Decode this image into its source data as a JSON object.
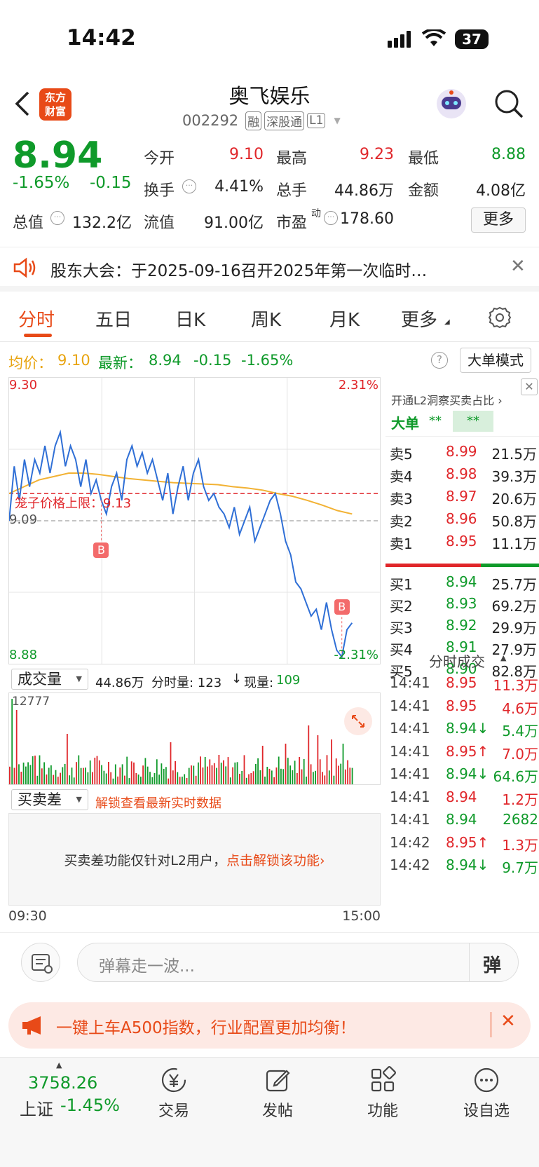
{
  "status_bar": {
    "time": "14:42",
    "battery": "37"
  },
  "header": {
    "logo_line1": "东方",
    "logo_line2": "财富",
    "title": "奥飞娱乐",
    "code": "002292",
    "badges": [
      "融",
      "深股通",
      "L1"
    ]
  },
  "quote": {
    "price": "8.94",
    "change_pct": "-1.65%",
    "change": "-0.15",
    "open_label": "今开",
    "open": "9.10",
    "high_label": "最高",
    "high": "9.23",
    "low_label": "最低",
    "low": "8.88",
    "turnover_label": "换手",
    "turnover": "4.41%",
    "volume_label": "总手",
    "volume": "44.86万",
    "amount_label": "金额",
    "amount": "4.08亿",
    "mktcap_label": "总值",
    "mktcap": "132.2亿",
    "float_label": "流值",
    "float": "91.00亿",
    "pe_label": "市盈",
    "pe_sup": "动",
    "pe": "178.60",
    "more_button": "更多"
  },
  "notice": {
    "text": "股东大会：于2025-09-16召开2025年第一次临时…"
  },
  "tabs": [
    {
      "label": "分时",
      "active": true
    },
    {
      "label": "五日"
    },
    {
      "label": "日K"
    },
    {
      "label": "周K"
    },
    {
      "label": "月K"
    },
    {
      "label": "更多"
    }
  ],
  "info_line": {
    "avg_label": "均价：",
    "avg": "9.10",
    "latest_label": "最新：",
    "latest": "8.94",
    "chg": "-0.15",
    "pct": "-1.65%",
    "mode_button": "大单模式"
  },
  "chart": {
    "y_max": "9.30",
    "y_min": "8.88",
    "pct_max": "2.31%",
    "pct_min": "-2.31%",
    "prev_close": "9.09",
    "cage_label": "笼子价格上限：",
    "cage_value": "9.13",
    "marker": "B",
    "volume_selector": "成交量",
    "volume_info": "44.86万",
    "volume_info2": "分时量: 123",
    "volume_info3": "现量: ",
    "volume_now": "109",
    "vol_max": "12777",
    "diff_selector": "买卖差",
    "diff_unlock": "解锁查看最新实时数据",
    "diff_msg": "买卖差功能仅针对L2用户，",
    "diff_link": "点击解锁该功能",
    "time_start": "09:30",
    "time_end": "15:00",
    "colors": {
      "price": "#2f6fd6",
      "avg": "#f2b234",
      "up": "#e0262a",
      "down": "#0f9a2a"
    }
  },
  "chart_data": {
    "type": "line",
    "y_range": [
      8.88,
      9.3
    ],
    "series": [
      {
        "values": [
          9.09,
          9.17,
          9.12,
          9.18,
          9.14,
          9.18,
          9.16,
          9.2,
          9.16,
          9.2,
          9.22,
          9.17,
          9.2,
          9.18,
          9.14,
          9.18,
          9.13,
          9.15,
          9.12,
          9.1,
          9.14,
          9.16,
          9.12,
          9.18,
          9.2,
          9.17,
          9.19,
          9.16,
          9.18,
          9.15,
          9.12,
          9.16,
          9.1,
          9.14,
          9.17,
          9.12,
          9.16,
          9.18,
          9.14,
          9.12,
          9.13,
          9.11,
          9.1,
          9.08,
          9.11,
          9.07,
          9.09,
          9.11,
          9.06,
          9.08,
          9.1,
          9.12,
          9.13,
          9.1,
          9.06,
          9.04,
          9.0,
          8.99,
          8.97,
          8.95,
          8.96,
          8.93,
          8.97,
          8.93,
          8.9,
          8.89,
          8.93,
          8.94
        ]
      },
      {
        "values": [
          9.13,
          9.14,
          9.15,
          9.155,
          9.16,
          9.16,
          9.158,
          9.155,
          9.152,
          9.15,
          9.148,
          9.146,
          9.145,
          9.144,
          9.143,
          9.14,
          9.138,
          9.135,
          9.13,
          9.126,
          9.12,
          9.113,
          9.105,
          9.1
        ]
      }
    ]
  },
  "order_book": {
    "l2_text": "开通L2洞察买卖占比",
    "big_label": "大单",
    "big_val1": "**",
    "big_val2": "**",
    "sells": [
      {
        "label": "卖5",
        "price": "8.99",
        "vol": "21.5万"
      },
      {
        "label": "卖4",
        "price": "8.98",
        "vol": "39.3万"
      },
      {
        "label": "卖3",
        "price": "8.97",
        "vol": "20.6万"
      },
      {
        "label": "卖2",
        "price": "8.96",
        "vol": "50.8万"
      },
      {
        "label": "卖1",
        "price": "8.95",
        "vol": "11.1万"
      }
    ],
    "buys": [
      {
        "label": "买1",
        "price": "8.94",
        "vol": "25.7万"
      },
      {
        "label": "买2",
        "price": "8.93",
        "vol": "69.2万"
      },
      {
        "label": "买3",
        "price": "8.92",
        "vol": "29.9万"
      },
      {
        "label": "买4",
        "price": "8.91",
        "vol": "27.9万"
      },
      {
        "label": "买5",
        "price": "8.90",
        "vol": "82.8万"
      }
    ]
  },
  "ticks": {
    "title": "分时成交",
    "rows": [
      {
        "time": "14:41",
        "price": "8.95",
        "arrow": "",
        "vol": "11.3万",
        "color": "red"
      },
      {
        "time": "14:41",
        "price": "8.95",
        "arrow": "",
        "vol": "4.6万",
        "color": "red"
      },
      {
        "time": "14:41",
        "price": "8.94↓",
        "arrow": "",
        "vol": "5.4万",
        "color": "green"
      },
      {
        "time": "14:41",
        "price": "8.95↑",
        "arrow": "",
        "vol": "7.0万",
        "color": "red"
      },
      {
        "time": "14:41",
        "price": "8.94↓",
        "arrow": "",
        "vol": "64.6万",
        "color": "green"
      },
      {
        "time": "14:41",
        "price": "8.94",
        "arrow": "",
        "vol": "1.2万",
        "color": "red"
      },
      {
        "time": "14:41",
        "price": "8.94",
        "arrow": "",
        "vol": "2682",
        "color": "green"
      },
      {
        "time": "14:42",
        "price": "8.95↑",
        "arrow": "",
        "vol": "1.3万",
        "color": "red"
      },
      {
        "time": "14:42",
        "price": "8.94↓",
        "arrow": "",
        "vol": "9.7万",
        "color": "green"
      }
    ]
  },
  "danmu": {
    "placeholder": "弹幕走一波...",
    "send": "弹"
  },
  "banner": {
    "text": "一键上车A500指数，行业配置更加均衡！"
  },
  "bottom_nav": {
    "index_value": "3758.26",
    "index_name": "上证",
    "index_pct": "-1.45%",
    "items": [
      "交易",
      "发帖",
      "功能",
      "设自选"
    ]
  }
}
